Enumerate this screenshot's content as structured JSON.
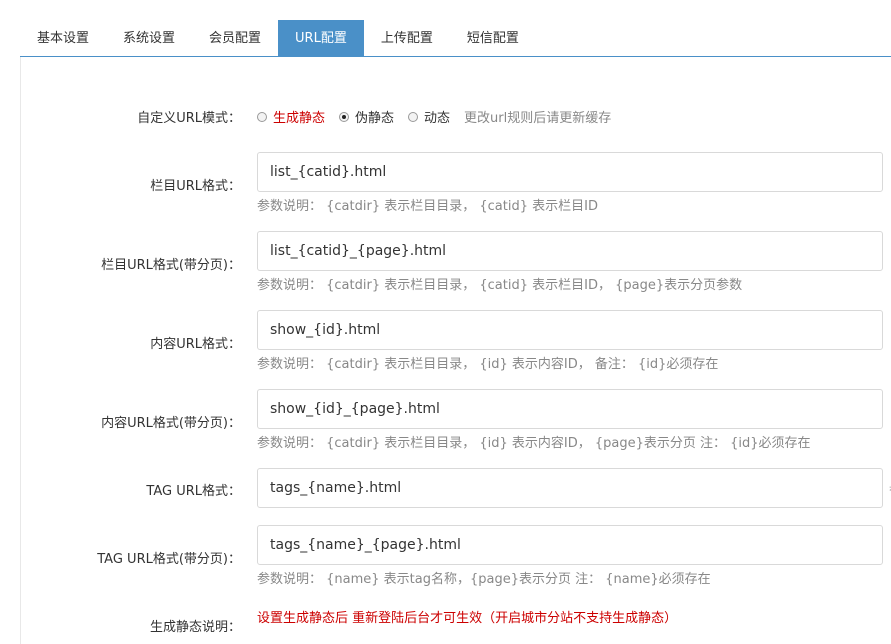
{
  "tabs": [
    {
      "label": "基本设置",
      "active": false
    },
    {
      "label": "系统设置",
      "active": false
    },
    {
      "label": "会员配置",
      "active": false
    },
    {
      "label": "URL配置",
      "active": true
    },
    {
      "label": "上传配置",
      "active": false
    },
    {
      "label": "短信配置",
      "active": false
    }
  ],
  "url_mode": {
    "label": "自定义URL模式：",
    "options": [
      {
        "label": "生成静态",
        "checked": false
      },
      {
        "label": "伪静态",
        "checked": true
      },
      {
        "label": "动态",
        "checked": false
      }
    ],
    "note": "更改url规则后请更新缓存"
  },
  "fields": [
    {
      "label": "栏目URL格式：",
      "value": "list_{catid}.html",
      "help": "参数说明： {catdir} 表示栏目目录， {catid} 表示栏目ID"
    },
    {
      "label": "栏目URL格式(带分页)：",
      "value": "list_{catid}_{page}.html",
      "help": "参数说明： {catdir} 表示栏目目录， {catid} 表示栏目ID， {page}表示分页参数"
    },
    {
      "label": "内容URL格式：",
      "value": "show_{id}.html",
      "help": "参数说明： {catdir} 表示栏目目录， {id} 表示内容ID， 备注： {id}必须存在"
    },
    {
      "label": "内容URL格式(带分页)：",
      "value": "show_{id}_{page}.html",
      "help": "参数说明： {catdir} 表示栏目目录， {id} 表示内容ID， {page}表示分页 注： {id}必须存在"
    },
    {
      "label": "TAG URL格式：",
      "value": "tags_{name}.html",
      "help": "",
      "edge_glyph": "参"
    },
    {
      "label": "TAG URL格式(带分页)：",
      "value": "tags_{name}_{page}.html",
      "help": "参数说明： {name} 表示tag名称，{page}表示分页 注： {name}必须存在"
    }
  ],
  "static_note": {
    "label": "生成静态说明：",
    "text": "设置生成静态后 重新登陆后台才可生效（开启城市分站不支持生成静态）"
  }
}
